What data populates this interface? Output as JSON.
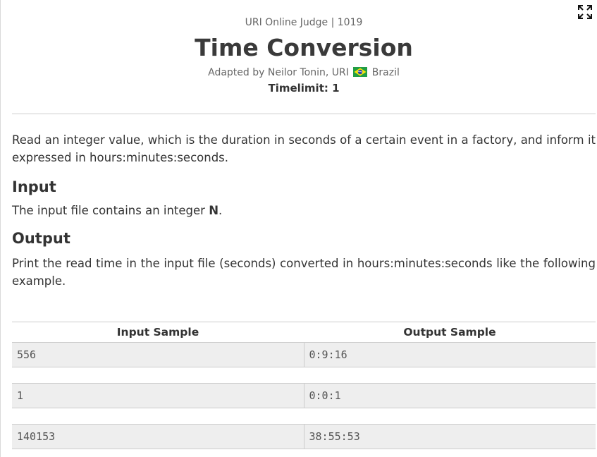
{
  "header": {
    "crumb": "URI Online Judge | 1019",
    "title": "Time Conversion",
    "adapted_prefix": "Adapted by Neilor Tonin, URI",
    "country": "Brazil",
    "timelimit": "Timelimit: 1"
  },
  "statement": {
    "description": "Read an integer value, which is the duration in seconds of a certain event in a factory, and inform it expressed in hours:minutes:seconds.",
    "input_heading": "Input",
    "input_text_prefix": "The input file contains an integer ",
    "input_var": "N",
    "input_text_suffix": ".",
    "output_heading": "Output",
    "output_text": "Print the read time in the input file (seconds) converted in hours:minutes:seconds like the following example."
  },
  "samples": {
    "input_header": "Input Sample",
    "output_header": "Output Sample",
    "rows": [
      {
        "input": "556",
        "output": "0:9:16"
      },
      {
        "input": "1",
        "output": "0:0:1"
      },
      {
        "input": "140153",
        "output": "38:55:53"
      }
    ]
  },
  "icons": {
    "expand": "expand-icon",
    "flag": "brazil-flag-icon"
  },
  "colors": {
    "sample_bg": "#eeeeee",
    "flag_green": "#229e45",
    "flag_yellow": "#f8e509",
    "flag_blue": "#2b49a3"
  }
}
